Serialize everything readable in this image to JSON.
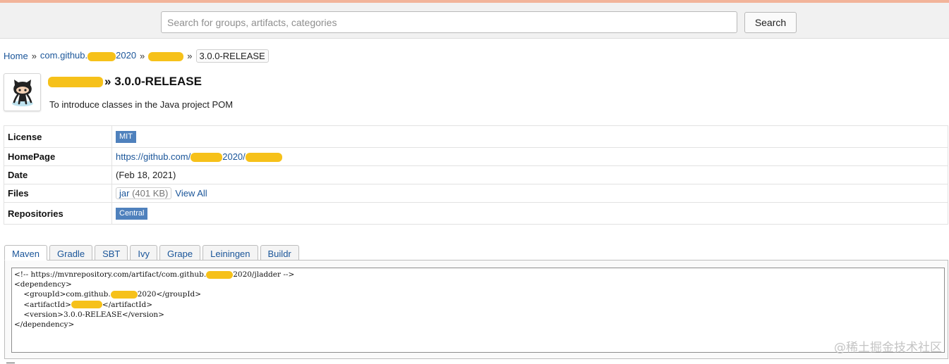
{
  "header": {
    "search_placeholder": "Search for groups, artifacts, categories",
    "search_value": "",
    "search_button": "Search"
  },
  "breadcrumb": {
    "home": "Home",
    "sep": "»",
    "group_prefix": "com.github.",
    "group_suffix": "2020",
    "current": "3.0.0-RELEASE"
  },
  "artifact": {
    "logo_icon": "github-octocat-icon",
    "title_sep": "»",
    "version": "3.0.0-RELEASE",
    "description": "To introduce classes in the Java project POM"
  },
  "info": {
    "license_label": "License",
    "license_value": "MIT",
    "homepage_label": "HomePage",
    "homepage_prefix": "https://github.com/",
    "homepage_mid": "2020/",
    "date_label": "Date",
    "date_value": "(Feb 18, 2021)",
    "files_label": "Files",
    "file_type": "jar",
    "file_size": "(401 KB)",
    "view_all": "View All",
    "repositories_label": "Repositories",
    "repository_value": "Central"
  },
  "tabs": [
    "Maven",
    "Gradle",
    "SBT",
    "Ivy",
    "Grape",
    "Leiningen",
    "Buildr"
  ],
  "active_tab": "Maven",
  "code": {
    "line1_a": "<!-- https://mvnrepository.com/artifact/com.github.",
    "line1_b": "2020/jladder -->",
    "line2": "<dependency>",
    "line3_a": "    <groupId>com.github.",
    "line3_b": "2020</groupId>",
    "line4_a": "    <artifactId>",
    "line4_b": "</artifactId>",
    "line5": "    <version>3.0.0-RELEASE</version>",
    "line6": "</dependency>"
  },
  "watermark": "@稀土掘金技术社区",
  "colors": {
    "link": "#1a5599",
    "tag_bg": "#4f81bd",
    "redaction": "#f6c11a"
  }
}
